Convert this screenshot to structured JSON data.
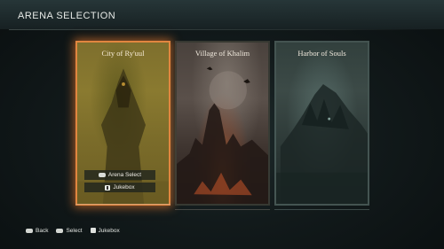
{
  "header": {
    "title": "ARENA SELECTION"
  },
  "arenas": [
    {
      "name": "City of Ry'uul",
      "selected": true
    },
    {
      "name": "Village of Khalim",
      "selected": false
    },
    {
      "name": "Harbor of Souls",
      "selected": false
    }
  ],
  "card_menu": {
    "arena_select": {
      "label": "Arena Select",
      "icon": "touchpad-button-icon"
    },
    "jukebox": {
      "label": "Jukebox",
      "icon": "square-button-icon"
    }
  },
  "footer": [
    {
      "label": "Back",
      "icon": "circle-button-icon"
    },
    {
      "label": "Select",
      "icon": "cross-button-icon"
    },
    {
      "label": "Jukebox",
      "icon": "square-button-icon"
    }
  ],
  "colors": {
    "selected_glow": "#e1863f",
    "header_text": "#e6e9e6"
  }
}
